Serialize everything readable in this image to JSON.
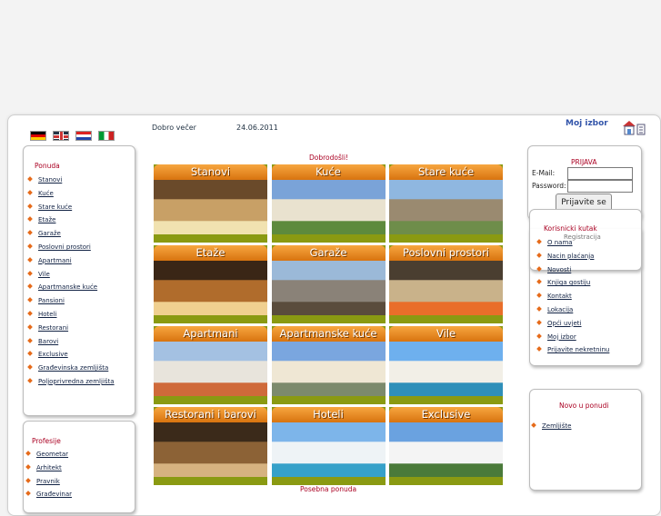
{
  "header": {
    "greeting": "Dobro večer",
    "date": "24.06.2011",
    "moj_izbor": "Moj izbor"
  },
  "ponuda": {
    "title": "Ponuda",
    "items": [
      "Stanovi",
      "Kuće",
      "Stare kuće",
      "Etaže",
      "Garaže",
      "Poslovni prostori",
      "Apartmani",
      "Vile",
      "Apartmanske kuće",
      "Pansioni",
      "Hoteli",
      "Restorani",
      "Barovi",
      "Exclusive",
      "Građevinska zemljišta",
      "Poljoprivredna zemljišta"
    ]
  },
  "profesije": {
    "title": "Profesije",
    "items": [
      "Geometar",
      "Arhitekt",
      "Pravnik",
      "Građevinar"
    ]
  },
  "main": {
    "title": "Dobrodošli!",
    "tiles": [
      "Stanovi",
      "Kuće",
      "Stare kuće",
      "Etaže",
      "Garaže",
      "Poslovni prostori",
      "Apartmani",
      "Apartmanske kuće",
      "Vile",
      "Restorani i barovi",
      "Hoteli",
      "Exclusive"
    ],
    "posebna": "Posebna ponuda"
  },
  "login": {
    "title": "PRIJAVA",
    "email_label": "E-Mail:",
    "password_label": "Password:",
    "button": "Prijavite se",
    "register": "Registracija"
  },
  "kutak": {
    "title": "Korisnicki kutak",
    "items": [
      "O nama",
      "Nacin plaćanja",
      "Novosti",
      "Knjiga gostiju",
      "Kontakt",
      "Lokacija",
      "Opći uvjeti",
      "Moj izbor",
      "Prijavite nekretninu"
    ]
  },
  "novo": {
    "title": "Novo u ponudi",
    "items": [
      "Zemljište"
    ]
  },
  "colors": {
    "accent": "#e66b1a",
    "title_red": "#aa0022",
    "tile_olive": "#8a9a12"
  },
  "icons": [
    "flag-de-icon",
    "flag-gb-icon",
    "flag-hr-icon",
    "flag-it-icon",
    "home-icon",
    "document-icon"
  ]
}
